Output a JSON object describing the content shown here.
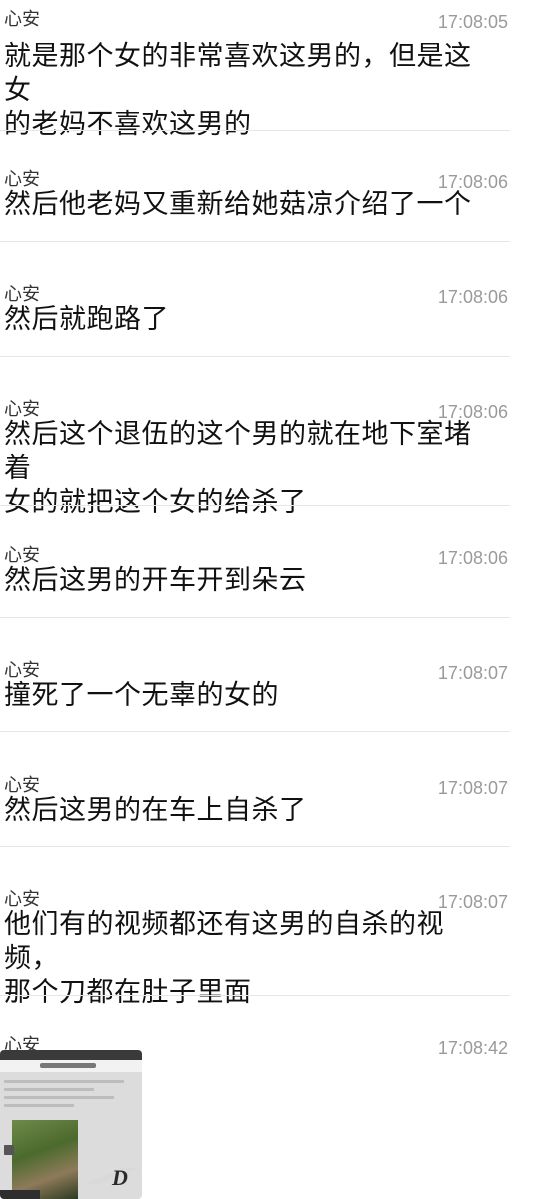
{
  "messages": [
    {
      "sender": "心安",
      "time": "17:08:05",
      "lines": [
        "就是那个女的非常喜欢这男的，但是这女",
        "的老妈不喜欢这男的"
      ]
    },
    {
      "sender": "心安",
      "time": "17:08:06",
      "lines": [
        "然后他老妈又重新给她菇凉介绍了一个"
      ]
    },
    {
      "sender": "心安",
      "time": "17:08:06",
      "lines": [
        "然后就跑路了"
      ]
    },
    {
      "sender": "心安",
      "time": "17:08:06",
      "lines": [
        "然后这个退伍的这个男的就在地下室堵着",
        "女的就把这个女的给杀了"
      ]
    },
    {
      "sender": "心安",
      "time": "17:08:06",
      "lines": [
        "然后这男的开车开到朵云"
      ]
    },
    {
      "sender": "心安",
      "time": "17:08:07",
      "lines": [
        "撞死了一个无辜的女的"
      ]
    },
    {
      "sender": "心安",
      "time": "17:08:07",
      "lines": [
        "然后这男的在车上自杀了"
      ]
    },
    {
      "sender": "心安",
      "time": "17:08:07",
      "lines": [
        "他们有的视频都还有这男的自杀的视频，",
        "那个刀都在肚子里面"
      ]
    },
    {
      "sender": "心安",
      "time": "17:08:42",
      "lines": []
    }
  ],
  "image_message": {
    "icon": "image-thumbnail-icon",
    "logo_text": "D"
  },
  "colors": {
    "time": "#9a9a9a",
    "divider": "#e6e6e6",
    "text": "#111111"
  }
}
